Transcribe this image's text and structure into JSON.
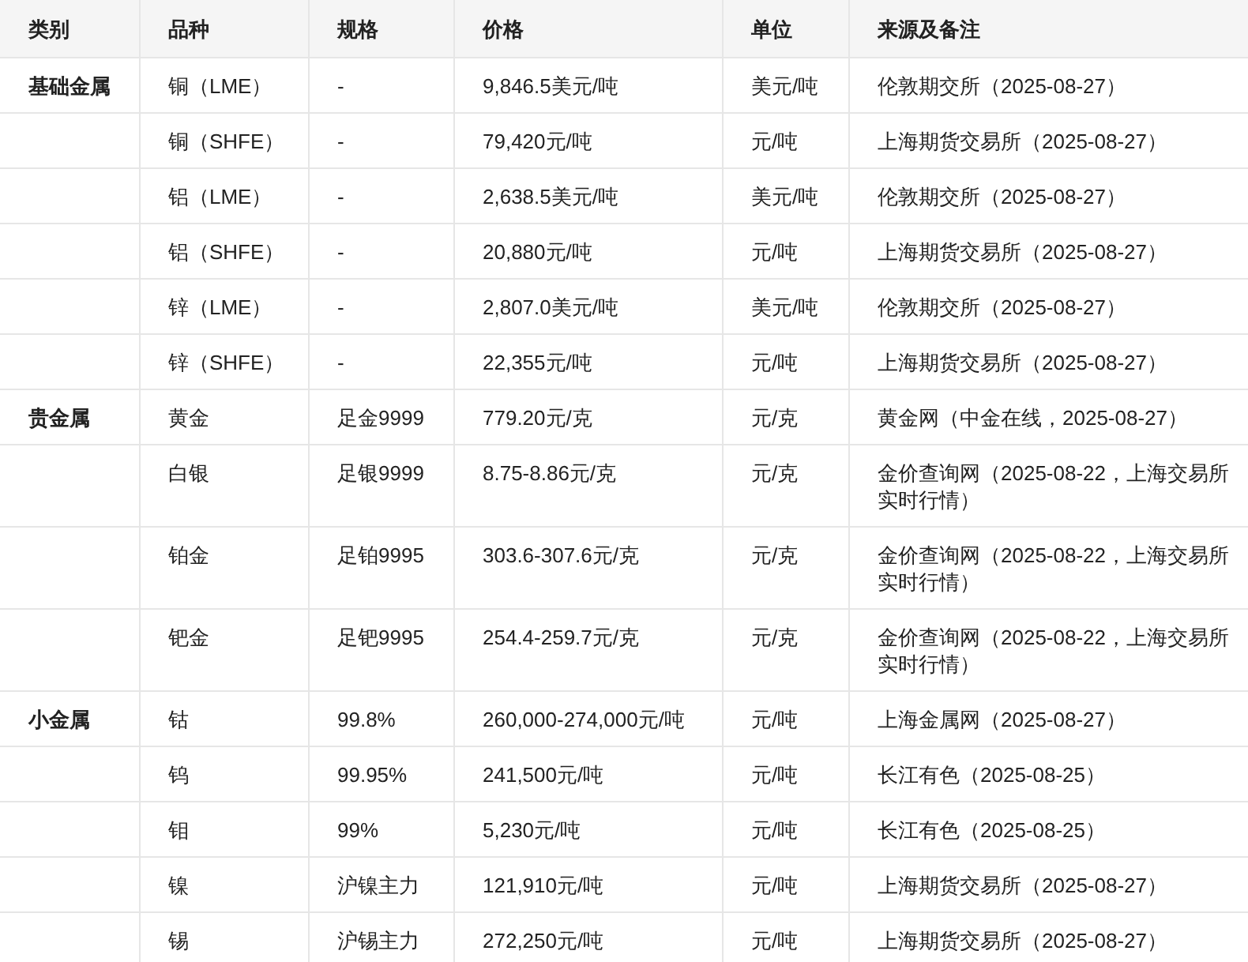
{
  "table": {
    "columns": [
      "类别",
      "品种",
      "规格",
      "价格",
      "单位",
      "来源及备注"
    ],
    "rows": [
      {
        "category": "基础金属",
        "variety": "铜（LME）",
        "spec": "-",
        "price": "9,846.5美元/吨",
        "unit": "美元/吨",
        "source": "伦敦期交所（2025-08-27）"
      },
      {
        "variety": "铜（SHFE）",
        "spec": "-",
        "price": "79,420元/吨",
        "unit": "元/吨",
        "source": "上海期货交易所（2025-08-27）"
      },
      {
        "variety": "铝（LME）",
        "spec": "-",
        "price": "2,638.5美元/吨",
        "unit": "美元/吨",
        "source": "伦敦期交所（2025-08-27）"
      },
      {
        "variety": "铝（SHFE）",
        "spec": "-",
        "price": "20,880元/吨",
        "unit": "元/吨",
        "source": "上海期货交易所（2025-08-27）"
      },
      {
        "variety": "锌（LME）",
        "spec": "-",
        "price": "2,807.0美元/吨",
        "unit": "美元/吨",
        "source": "伦敦期交所（2025-08-27）"
      },
      {
        "variety": "锌（SHFE）",
        "spec": "-",
        "price": "22,355元/吨",
        "unit": "元/吨",
        "source": "上海期货交易所（2025-08-27）"
      },
      {
        "category": "贵金属",
        "variety": "黄金",
        "spec": "足金9999",
        "price": "779.20元/克",
        "unit": "元/克",
        "source": "黄金网（中金在线，2025-08-27）"
      },
      {
        "variety": "白银",
        "spec": "足银9999",
        "price": "8.75-8.86元/克",
        "unit": "元/克",
        "source": "金价查询网（2025-08-22，上海交易所实时行情）"
      },
      {
        "variety": "铂金",
        "spec": "足铂9995",
        "price": "303.6-307.6元/克",
        "unit": "元/克",
        "source": "金价查询网（2025-08-22，上海交易所实时行情）"
      },
      {
        "variety": "钯金",
        "spec": "足钯9995",
        "price": "254.4-259.7元/克",
        "unit": "元/克",
        "source": "金价查询网（2025-08-22，上海交易所实时行情）"
      },
      {
        "category": "小金属",
        "variety": "钴",
        "spec": "99.8%",
        "price": "260,000-274,000元/吨",
        "unit": "元/吨",
        "source": "上海金属网（2025-08-27）"
      },
      {
        "variety": "钨",
        "spec": "99.95%",
        "price": "241,500元/吨",
        "unit": "元/吨",
        "source": "长江有色（2025-08-25）"
      },
      {
        "variety": "钼",
        "spec": "99%",
        "price": "5,230元/吨",
        "unit": "元/吨",
        "source": "长江有色（2025-08-25）"
      },
      {
        "variety": "镍",
        "spec": "沪镍主力",
        "price": "121,910元/吨",
        "unit": "元/吨",
        "source": "上海期货交易所（2025-08-27）"
      },
      {
        "variety": "锡",
        "spec": "沪锡主力",
        "price": "272,250元/吨",
        "unit": "元/吨",
        "source": "上海期货交易所（2025-08-27）"
      }
    ]
  }
}
